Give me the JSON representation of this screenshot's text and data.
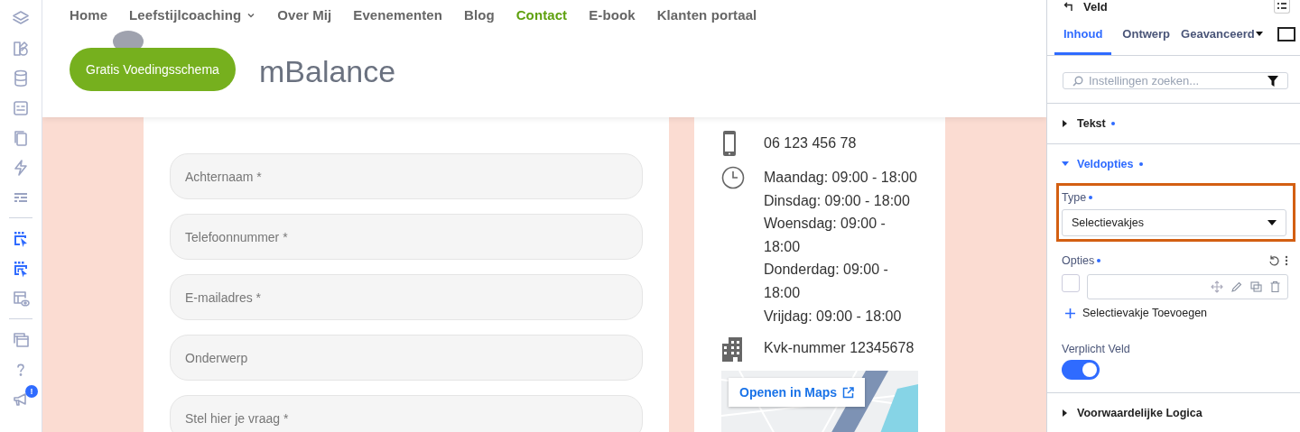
{
  "sidebar": {
    "tools": [
      {
        "kind": "layers",
        "active": false
      },
      {
        "kind": "shapes",
        "active": false
      },
      {
        "kind": "database",
        "active": false
      },
      {
        "kind": "form",
        "active": false
      },
      {
        "kind": "pages",
        "active": false
      },
      {
        "kind": "bolt",
        "active": false
      },
      {
        "kind": "lines",
        "active": false
      },
      {
        "kind": "divider"
      },
      {
        "kind": "select",
        "active": true
      },
      {
        "kind": "select-multi",
        "active": true
      },
      {
        "kind": "layout-eye",
        "active": false
      },
      {
        "kind": "divider"
      },
      {
        "kind": "windows",
        "active": false
      },
      {
        "kind": "help",
        "active": false
      },
      {
        "kind": "megaphone",
        "active": false,
        "badge": "!"
      }
    ]
  },
  "site_header": {
    "nav": [
      {
        "label": "Home",
        "selected": false,
        "dropdown": false
      },
      {
        "label": "Leefstijlcoaching",
        "selected": false,
        "dropdown": true
      },
      {
        "label": "Over Mij",
        "selected": false,
        "dropdown": false
      },
      {
        "label": "Evenementen",
        "selected": false,
        "dropdown": false
      },
      {
        "label": "Blog",
        "selected": false,
        "dropdown": false
      },
      {
        "label": "Contact",
        "selected": true,
        "dropdown": false
      },
      {
        "label": "E-book",
        "selected": false,
        "dropdown": false
      },
      {
        "label": "Klanten portaal",
        "selected": false,
        "dropdown": false
      }
    ],
    "logo_text": "mBalance",
    "cta_button": "Gratis Voedingsschema"
  },
  "form": {
    "fields": [
      {
        "placeholder": "Achternaam *"
      },
      {
        "placeholder": "Telefoonnummer *"
      },
      {
        "placeholder": "E-mailadres *"
      },
      {
        "placeholder": "Onderwerp"
      },
      {
        "placeholder": "Stel hier je vraag *"
      }
    ]
  },
  "contact": {
    "items": [
      {
        "kind": "phone",
        "lines": [
          "06 123 456 78"
        ]
      },
      {
        "kind": "clock",
        "lines": [
          "Maandag: 09:00 - 18:00",
          "Dinsdag: 09:00 - 18:00",
          "Woensdag: 09:00 - 18:00",
          "Donderdag: 09:00 - 18:00",
          "Vrijdag: 09:00 - 18:00"
        ]
      },
      {
        "kind": "building",
        "lines": [
          "Kvk-nummer 12345678"
        ]
      }
    ],
    "map_link": "Openen in Maps"
  },
  "panel": {
    "title": "Veld",
    "tabs": [
      {
        "label": "Inhoud",
        "selected": true,
        "dropdown": false
      },
      {
        "label": "Ontwerp",
        "selected": false,
        "dropdown": false
      },
      {
        "label": "Geavanceerd",
        "selected": false,
        "dropdown": true
      }
    ],
    "search": {
      "placeholder": "Instellingen zoeken..."
    },
    "sections": [
      {
        "title": "Tekst",
        "expanded": false,
        "dot": true
      },
      {
        "title": "Veldopties",
        "expanded": true,
        "dot": true
      },
      {
        "title": "Voorwaardelijke Logica",
        "expanded": false,
        "dot": false
      }
    ],
    "type_label": "Type",
    "type_value": "Selectievakjes",
    "options_label": "Opties",
    "options": [
      {
        "checked": false
      }
    ],
    "add_option": "Selectievakje Toevoegen",
    "required_label": "Verplicht Veld",
    "required": {
      "on": true
    }
  }
}
